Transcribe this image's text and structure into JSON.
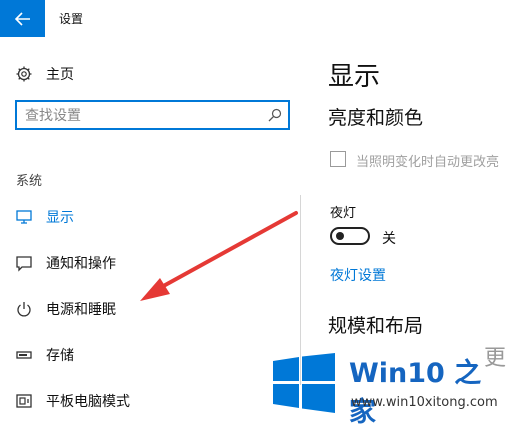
{
  "window": {
    "title": "设置",
    "back_icon": "arrow-left-icon"
  },
  "sidebar": {
    "home": {
      "icon": "gear-icon",
      "label": "主页"
    },
    "search": {
      "placeholder": "查找设置",
      "icon": "search-icon"
    },
    "section_label": "系统",
    "items": [
      {
        "icon": "monitor-icon",
        "label": "显示",
        "active": true
      },
      {
        "icon": "notification-icon",
        "label": "通知和操作",
        "active": false
      },
      {
        "icon": "power-icon",
        "label": "电源和睡眠",
        "active": false
      },
      {
        "icon": "storage-icon",
        "label": "存储",
        "active": false
      },
      {
        "icon": "tablet-mode-icon",
        "label": "平板电脑模式",
        "active": false
      }
    ]
  },
  "main": {
    "title": "显示",
    "brightness_heading": "亮度和颜色",
    "auto_brightness_label": "当照明变化时自动更改亮",
    "night_light_label": "夜灯",
    "night_light_state": "关",
    "night_light_settings_link": "夜灯设置",
    "scale_heading": "规模和布局",
    "clipped_char": "更"
  },
  "watermark": {
    "brand": "Win10 之家",
    "url": "www.win10xitong.com",
    "colors": [
      "#0078d7",
      "#1565c0"
    ]
  },
  "colors": {
    "accent": "#0078d7",
    "annotation_arrow": "#e53935"
  }
}
